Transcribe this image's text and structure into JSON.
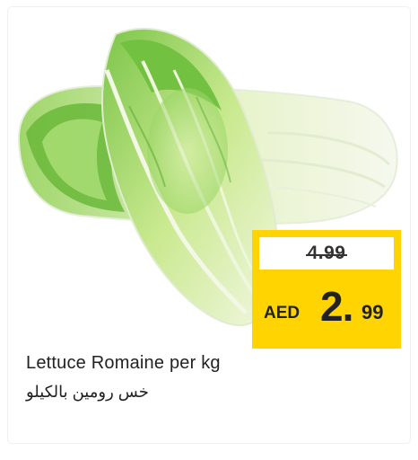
{
  "product": {
    "name_en": "Lettuce Romaine per kg",
    "name_ar": "خس رومين بالكيلو",
    "image": "romaine-lettuce-image"
  },
  "price": {
    "old": "4.99",
    "currency": "AED",
    "new_main": "2.",
    "new_decimals": "99"
  },
  "colors": {
    "tag_yellow": "#ffd400",
    "text": "#222222"
  }
}
